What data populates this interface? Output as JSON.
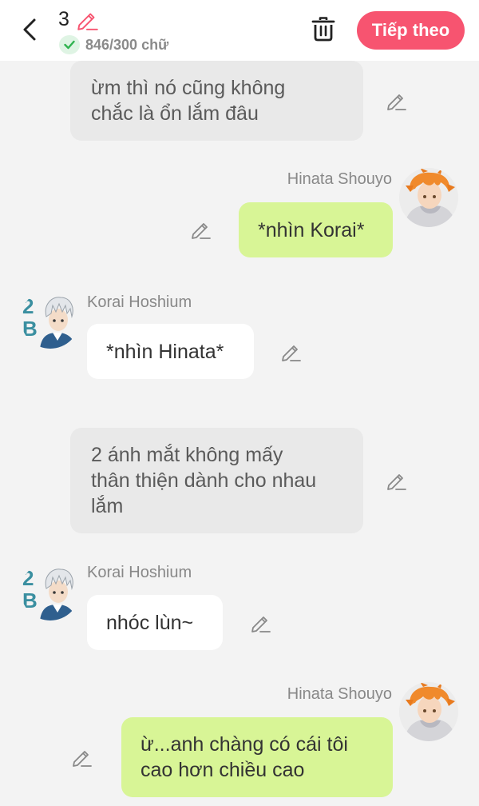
{
  "header": {
    "chapter_number": "3",
    "word_count": "846/300 chữ",
    "next_label": "Tiếp theo"
  },
  "colors": {
    "accent": "#f75470",
    "my_bubble": "#d8f596",
    "narration_bubble": "#e9e9e9",
    "other_bubble": "#ffffff",
    "check_green": "#2fb34f"
  },
  "messages": [
    {
      "type": "narration",
      "lines": [
        "ừm thì nó cũng không",
        "chắc là ổn lắm đâu"
      ]
    },
    {
      "type": "me",
      "speaker": "Hinata Shouyo",
      "lines": [
        "*nhìn Korai*"
      ],
      "avatar_icon": "orange-hair-avatar-icon"
    },
    {
      "type": "other",
      "speaker": "Korai Hoshium",
      "lines": [
        "*nhìn Hinata*"
      ],
      "avatar_icon": "white-hair-avatar-icon"
    },
    {
      "type": "narration",
      "lines": [
        "2 ánh mắt không mấy",
        "thân thiện dành cho nhau",
        "lắm"
      ]
    },
    {
      "type": "other",
      "speaker": "Korai Hoshium",
      "lines": [
        "nhóc lùn~"
      ],
      "avatar_icon": "white-hair-avatar-icon"
    },
    {
      "type": "me",
      "speaker": "Hinata Shouyo",
      "lines": [
        "ừ...anh chàng có cái tôi",
        "cao hơn chiều cao"
      ],
      "avatar_icon": "orange-hair-avatar-icon"
    }
  ]
}
